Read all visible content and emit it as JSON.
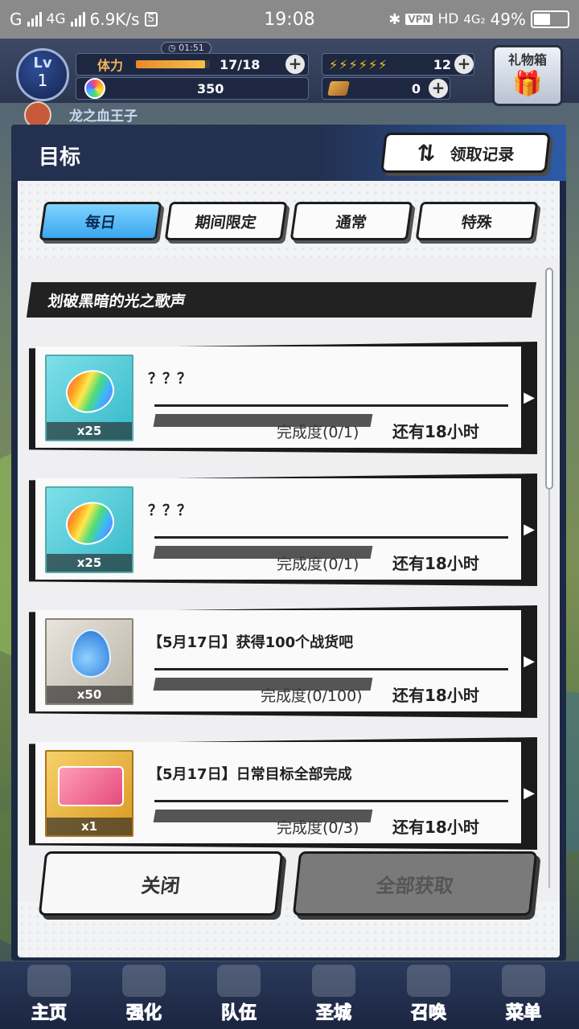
{
  "status_bar": {
    "carrier_prefix": "G",
    "network": "4G",
    "speed": "6.9K/s",
    "sim_badge": "S",
    "time": "19:08",
    "vpn": "VPN",
    "hd": "HD",
    "network_right": "4G₂",
    "battery": "49%",
    "battery_level": 0.49
  },
  "hud": {
    "lv_label": "Lv",
    "level": "1",
    "stamina_label": "体力",
    "stamina_timer": "01:51",
    "stamina_value": "17/18",
    "stamina_fraction": 0.94,
    "bolts_value": "12",
    "gems_value": "350",
    "coins_value": "0",
    "gift_box_label": "礼物箱",
    "player_name": "龙之血王子"
  },
  "dialog": {
    "title": "目标",
    "records_button": "领取记录",
    "tabs": [
      {
        "label": "每日",
        "active": true
      },
      {
        "label": "期间限定",
        "active": false
      },
      {
        "label": "通常",
        "active": false
      },
      {
        "label": "特殊",
        "active": false
      }
    ],
    "section_title": "划破黑暗的光之歌声",
    "tasks": [
      {
        "reward_type": "rainbow-gem",
        "reward_count": "x25",
        "name": "？？？",
        "progress": "完成度(0/1)",
        "remaining": "还有18小时",
        "progress_fraction": 0.0
      },
      {
        "reward_type": "rainbow-gem",
        "reward_count": "x25",
        "name": "？？？",
        "progress": "完成度(0/1)",
        "remaining": "还有18小时",
        "progress_fraction": 0.0
      },
      {
        "reward_type": "water-drop",
        "reward_count": "x50",
        "name": "【5月17日】获得100个战货吧",
        "progress": "完成度(0/100)",
        "remaining": "还有18小时",
        "progress_fraction": 0.0
      },
      {
        "reward_type": "ticket",
        "reward_count": "x1",
        "name": "【5月17日】日常目标全部完成",
        "progress": "完成度(0/3)",
        "remaining": "还有18小时",
        "progress_fraction": 0.0
      }
    ],
    "close_button": "关闭",
    "claim_all_button": "全部获取"
  },
  "bottom_nav": [
    "主页",
    "强化",
    "队伍",
    "圣城",
    "召唤",
    "菜单"
  ],
  "colors": {
    "active_tab": "#3aa6ee",
    "nav_label": "#ff4d8a",
    "progress_fill": "#4fc3f7"
  }
}
